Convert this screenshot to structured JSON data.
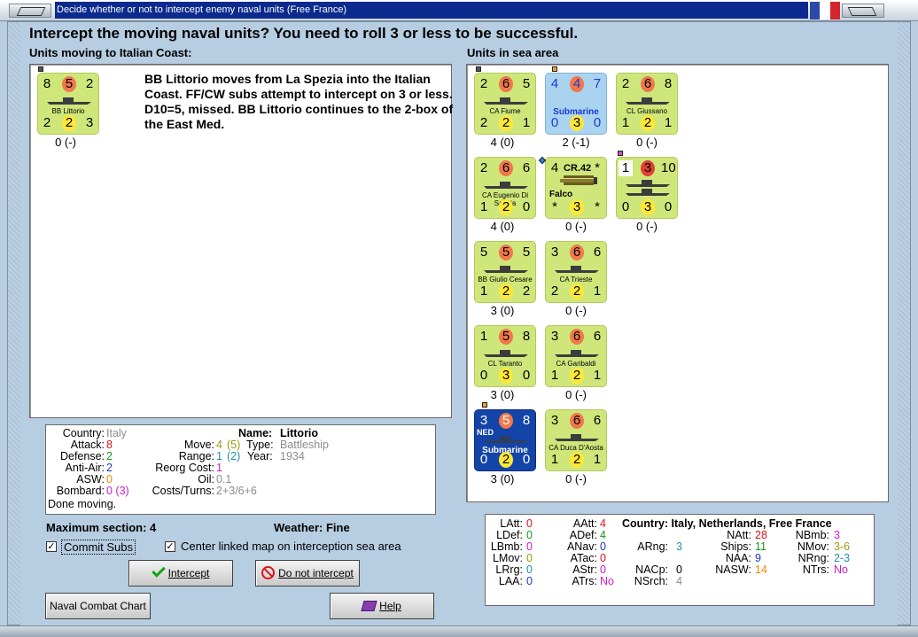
{
  "window": {
    "title": "Decide whether or not to intercept enemy naval units (Free France)",
    "flag_colors": [
      "#2b4aa8",
      "#ffffff",
      "#d3252c"
    ]
  },
  "heading": "Intercept the moving naval units?  You need to roll 3 or less to be successful.",
  "left_panel": {
    "title": "Units moving to Italian Coast:",
    "unit": {
      "tl": "8",
      "tc": "5",
      "tr": "2",
      "name": "BB Littorio",
      "bl": "2",
      "bc": "2",
      "br": "3",
      "caption": "0 (-)"
    },
    "narrative": "BB Littorio moves from La Spezia into the Italian Coast.  FF/CW subs attempt to intercept on 3 or less.  D10=5, missed.  BB Littorio continues to the 2-box of the East Med."
  },
  "right_panel": {
    "title": "Units in sea area",
    "units": [
      {
        "tl": "2",
        "tc": "6",
        "tr": "5",
        "name": "CA Fiume",
        "bl": "2",
        "bc": "2",
        "br": "1",
        "caption": "4 (0)"
      },
      {
        "tl": "4",
        "tc": "4",
        "tr": "7",
        "name": "Submarine",
        "bl": "0",
        "bc": "3",
        "br": "0",
        "caption": "2 (-1)"
      },
      {
        "tl": "2",
        "tc": "6",
        "tr": "8",
        "name": "CL Giussano",
        "bl": "1",
        "bc": "2",
        "br": "1",
        "caption": "0 (-)"
      },
      {
        "tl": "2",
        "tc": "6",
        "tr": "6",
        "name": "CA Eugenio Di Savoia",
        "bl": "1",
        "bc": "2",
        "br": "0",
        "caption": "4 (0)"
      },
      {
        "tl": "4",
        "tc": "CR.42",
        "tr": "*",
        "name": "Falco",
        "bl": "*",
        "bc": "3",
        "br": "*",
        "caption": "0 (-)"
      },
      {
        "tl": "1",
        "tc": "3",
        "tr": "10",
        "name": "",
        "bl": "0",
        "bc": "3",
        "br": "0",
        "caption": "0 (-)"
      },
      {
        "tl": "5",
        "tc": "5",
        "tr": "5",
        "name": "BB Giulio Cesare",
        "bl": "1",
        "bc": "2",
        "br": "2",
        "caption": "3 (0)"
      },
      {
        "tl": "3",
        "tc": "6",
        "tr": "6",
        "name": "CA Trieste",
        "bl": "2",
        "bc": "2",
        "br": "1",
        "caption": "0 (-)"
      },
      {
        "tl": "1",
        "tc": "5",
        "tr": "8",
        "name": "CL Taranto",
        "bl": "0",
        "bc": "3",
        "br": "0",
        "caption": "3 (0)"
      },
      {
        "tl": "3",
        "tc": "6",
        "tr": "6",
        "name": "CA Garibaldi",
        "bl": "1",
        "bc": "2",
        "br": "1",
        "caption": "0 (-)"
      },
      {
        "tl": "3",
        "tc": "5",
        "tr": "8",
        "name": "Submarine",
        "flag": "NED",
        "bl": "0",
        "bc": "2",
        "br": "0",
        "caption": "3 (0)"
      },
      {
        "tl": "3",
        "tc": "6",
        "tr": "6",
        "name": "CA Duca D'Aosta",
        "bl": "1",
        "bc": "2",
        "br": "1",
        "caption": "0 (-)"
      }
    ]
  },
  "unit_info": {
    "country_label": "Country:",
    "country": "Italy",
    "attack_label": "Attack:",
    "attack": "8",
    "defense_label": "Defense:",
    "defense": "2",
    "antiair_label": "Anti-Air:",
    "antiair": "2",
    "asw_label": "ASW:",
    "asw": "0",
    "bombard_label": "Bombard:",
    "bombard": "0 (3)",
    "status": "Done moving.",
    "name_label": "Name:",
    "name": "Littorio",
    "move_label": "Move:",
    "move": "4",
    "move_alt": "(5)",
    "type_label": "Type:",
    "type": "Battleship",
    "range_label": "Range:",
    "range": "1",
    "range_alt": "(2)",
    "year_label": "Year:",
    "year": "1934",
    "reorg_label": "Reorg Cost:",
    "reorg": "1",
    "oil_label": "Oil:",
    "oil": "0.1",
    "costs_label": "Costs/Turns:",
    "costs": "2+3/6+6"
  },
  "max_section": "Maximum section: 4",
  "weather": "Weather:  Fine",
  "commit_subs": {
    "label": "Commit Subs",
    "checked": "✓"
  },
  "center_map": {
    "label": "Center linked map on interception sea area",
    "checked": "✓"
  },
  "buttons": {
    "intercept": "Intercept",
    "do_not_intercept": "Do not intercept",
    "naval_combat_chart": "Naval Combat Chart",
    "help": "Help"
  },
  "stats": {
    "country": "Country: Italy, Netherlands, Free France",
    "latt_l": "LAtt:",
    "latt": "0",
    "ldef_l": "LDef:",
    "ldef": "0",
    "lbmb_l": "LBmb:",
    "lbmb": "0",
    "lmov_l": "LMov:",
    "lmov": "0",
    "lrg_l": "LRrg:",
    "lrg": "0",
    "laa_l": "LAA:",
    "laa": "0",
    "aatt_l": "AAtt:",
    "aatt": "4",
    "adef_l": "ADef:",
    "adef": "4",
    "anav_l": "ANav:",
    "anav": "0",
    "atac_l": "ATac:",
    "atac": "0",
    "astr_l": "AStr:",
    "astr": "0",
    "atrs_l": "ATrs:",
    "atrs": "No",
    "arng_l": "ARng:",
    "arng": "3",
    "nacp_l": "NACp:",
    "nacp": "0",
    "nsrch_l": "NSrch:",
    "nsrch": "4",
    "natt_l": "NAtt:",
    "natt": "28",
    "ships_l": "Ships:",
    "ships": "11",
    "naa_l": "NAA:",
    "naa": "9",
    "nasw_l": "NASW:",
    "nasw": "14",
    "nbmb_l": "NBmb:",
    "nbmb": "3",
    "nmov_l": "NMov:",
    "nmov": "3-6",
    "nrng_l": "NRng:",
    "nrng": "2-3",
    "ntrs_l": "NTrs:",
    "ntrs": "No"
  }
}
